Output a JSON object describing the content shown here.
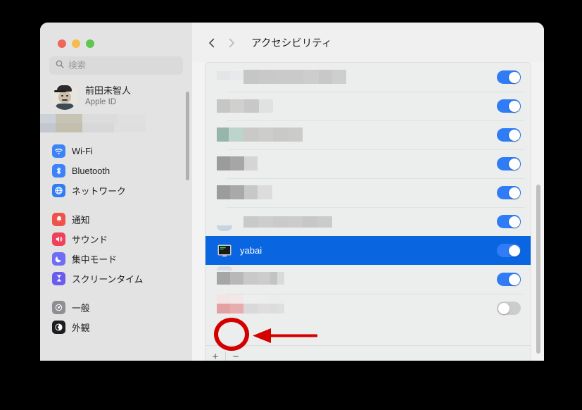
{
  "window": {
    "traffic_lights": [
      {
        "name": "close",
        "color": "#f2655a"
      },
      {
        "name": "minimize",
        "color": "#f5bd4f"
      },
      {
        "name": "zoom",
        "color": "#61c554"
      }
    ]
  },
  "sidebar": {
    "search": {
      "placeholder": "検索",
      "value": "",
      "icon": "search-icon"
    },
    "profile": {
      "name": "前田未智人",
      "subtitle": "Apple ID",
      "avatar": "user-avatar"
    },
    "groups": [
      {
        "items": [
          {
            "label": "Wi-Fi",
            "icon": "wifi-icon",
            "color": "#3d82f6"
          },
          {
            "label": "Bluetooth",
            "icon": "bluetooth-icon",
            "color": "#3d82f6"
          },
          {
            "label": "ネットワーク",
            "icon": "network-globe-icon",
            "color": "#2f7cf6"
          }
        ]
      },
      {
        "items": [
          {
            "label": "通知",
            "icon": "notifications-bell-icon",
            "color": "#f0514a"
          },
          {
            "label": "サウンド",
            "icon": "sound-speaker-icon",
            "color": "#f0415a"
          },
          {
            "label": "集中モード",
            "icon": "focus-moon-icon",
            "color": "#6f6cf5"
          },
          {
            "label": "スクリーンタイム",
            "icon": "screen-time-hourglass-icon",
            "color": "#6a5cf0"
          }
        ]
      },
      {
        "items": [
          {
            "label": "一般",
            "icon": "general-gear-icon",
            "color": "#8e8e93"
          },
          {
            "label": "外観",
            "icon": "appearance-contrast-icon",
            "color": "#1d1d1f"
          }
        ]
      }
    ]
  },
  "toolbar": {
    "back_icon": "chevron-left-icon",
    "forward_icon": "chevron-right-icon",
    "title": "アクセシビリティ"
  },
  "main": {
    "rows": [
      {
        "name": "",
        "redacted": true,
        "toggle": "on",
        "blocks": [
          {
            "x": 0,
            "y": 2,
            "w": 38,
            "h": 13,
            "shades": [
              "#e3e5e6",
              "#e7e9ea"
            ]
          },
          {
            "x": 38,
            "y": 2,
            "w": 146,
            "h": 20,
            "shades": [
              "#c6c6c6",
              "#c9c9c9",
              "#cacaca",
              "#cdcdcd",
              "#c8c8c8",
              "#cecece"
            ]
          }
        ]
      },
      {
        "name": "",
        "redacted": true,
        "toggle": "on",
        "blocks": [
          {
            "x": 0,
            "y": 4,
            "w": 80,
            "h": 19,
            "shades": [
              "#c6c6c5",
              "#d0d0ce",
              "#c8c8c8",
              "#e0e1e1"
            ]
          }
        ]
      },
      {
        "name": "",
        "redacted": true,
        "toggle": "on",
        "blocks": [
          {
            "x": 0,
            "y": 3,
            "w": 122,
            "h": 20,
            "shades": [
              "#97b6ab",
              "#bcd4cc",
              "#c9c9c8",
              "#cdcdcb",
              "#c9c9c7",
              "#cbcbc9"
            ]
          }
        ]
      },
      {
        "name": "",
        "redacted": true,
        "toggle": "on",
        "blocks": [
          {
            "x": 0,
            "y": 3,
            "w": 58,
            "h": 20,
            "shades": [
              "#9b9b9b",
              "#a6a6a6",
              "#d5d5d5"
            ]
          }
        ]
      },
      {
        "name": "",
        "redacted": true,
        "toggle": "on",
        "blocks": [
          {
            "x": 0,
            "y": 3,
            "w": 79,
            "h": 20,
            "shades": [
              "#9c9c9c",
              "#a9a9a9",
              "#c8c8c8",
              "#dcdcdc"
            ]
          }
        ]
      },
      {
        "name": "",
        "redacted": true,
        "toggle": "on",
        "blocks": [
          {
            "x": 38,
            "y": 6,
            "w": 126,
            "h": 16,
            "shades": [
              "#c9c9c9",
              "#cdcdcd",
              "#cacaca",
              "#cccccc",
              "#c7c7c7",
              "#cbcbcb"
            ]
          }
        ]
      },
      {
        "name": "yabai",
        "redacted": false,
        "selected": true,
        "toggle": "on",
        "icon": "terminal-icon"
      },
      {
        "name": "",
        "redacted": true,
        "toggle": "on",
        "blocks": [
          {
            "x": 0,
            "y": 3,
            "w": 96,
            "h": 18,
            "shades": [
              "#a6a6a6",
              "#b8b8b8",
              "#c9c9c9",
              "#cccccc",
              "#c3c3c3",
              "#dadada"
            ]
          }
        ]
      },
      {
        "name": "",
        "redacted": true,
        "toggle": "off",
        "blocks": [
          {
            "x": 0,
            "y": 0,
            "w": 96,
            "h": 14,
            "shades": [
              "#f3e5e6",
              "#f3e7e8",
              "#edeeee",
              "#ededee",
              "#ececed",
              "#ebecec"
            ]
          },
          {
            "x": 0,
            "y": 14,
            "w": 96,
            "h": 14,
            "shades": [
              "#e3a1a1",
              "#e7adad",
              "#d9d9d9",
              "#dedede",
              "#dcdcdc",
              "#dfdfdf"
            ]
          }
        ]
      }
    ],
    "footer": {
      "add_label": "+",
      "remove_label": "−"
    }
  },
  "annotations": {
    "highlight_color": "#d40000",
    "circle_target": "remove-button",
    "arrow_direction": "left"
  }
}
